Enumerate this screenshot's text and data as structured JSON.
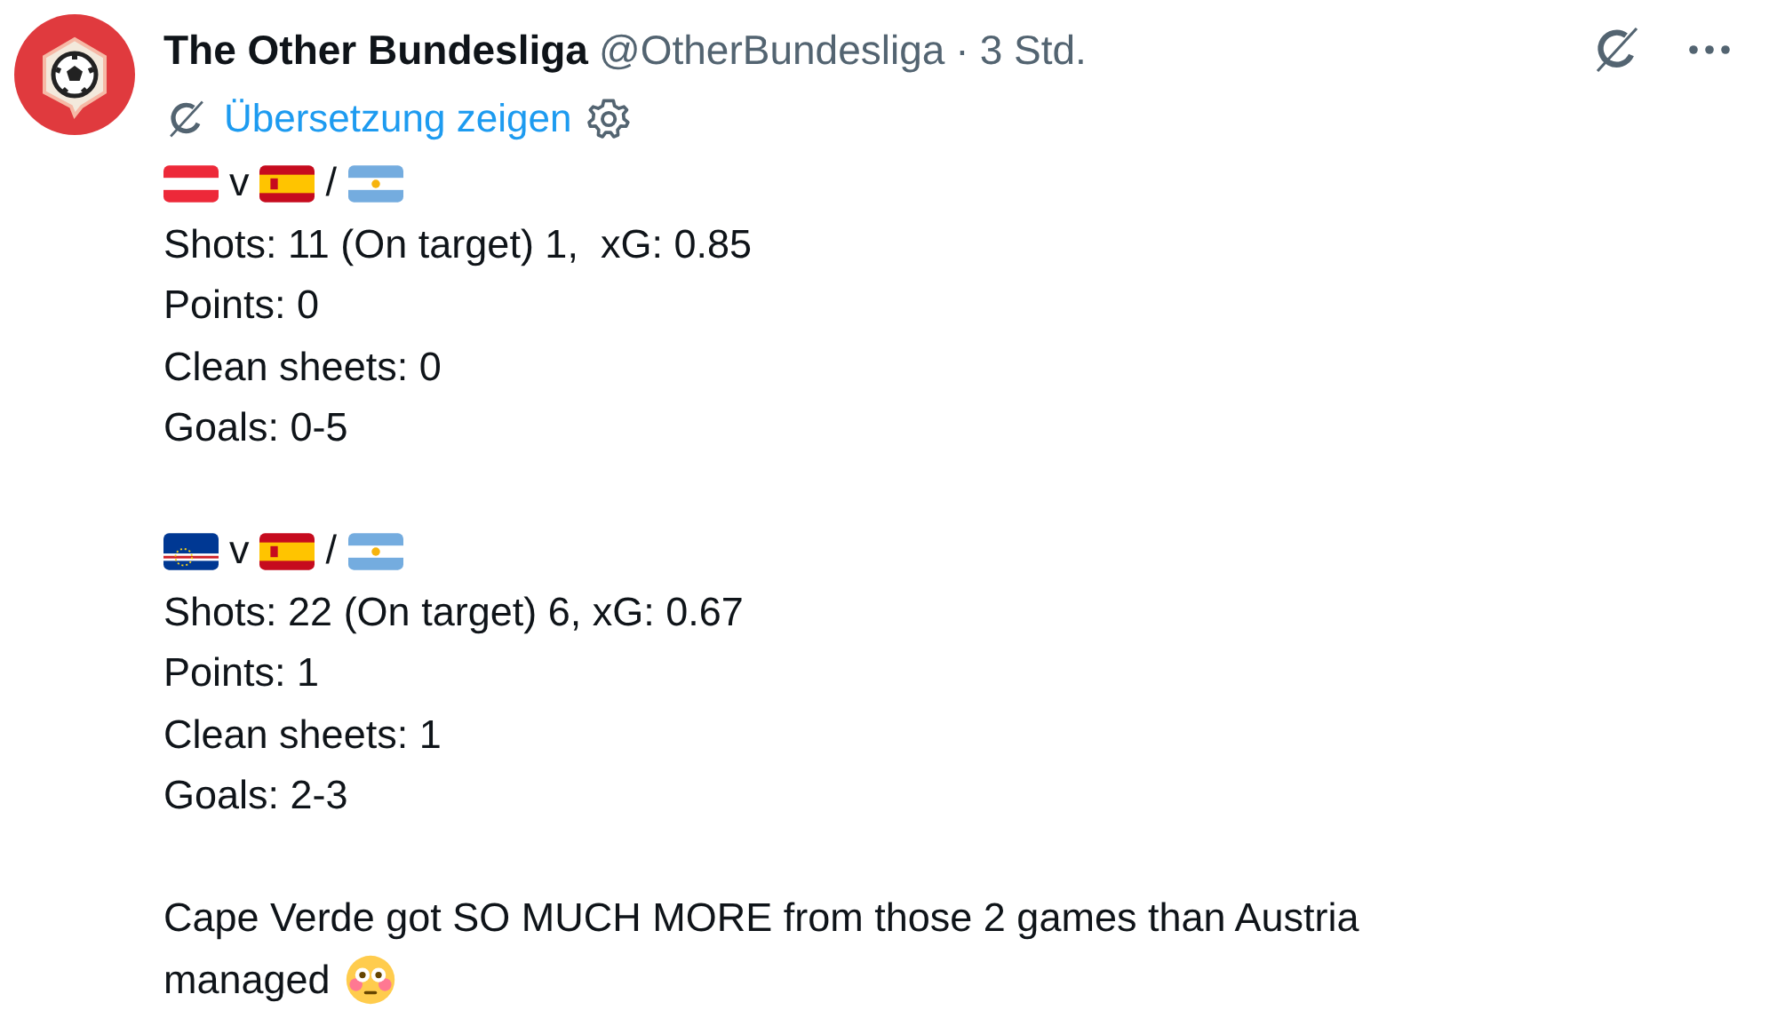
{
  "author": {
    "name": "The Other Bundesliga",
    "handle": "@OtherBundesliga",
    "separator": "·",
    "time": "3 Std."
  },
  "translate": {
    "label": "Übersetzung zeigen"
  },
  "body": [
    {
      "kind": "flags",
      "parts": [
        {
          "kind": "flag-austria"
        },
        {
          "kind": "text",
          "text": "v"
        },
        {
          "kind": "flag-spain"
        },
        {
          "kind": "text",
          "text": "/"
        },
        {
          "kind": "flag-argentina"
        }
      ]
    },
    {
      "kind": "line",
      "text": "Shots: 11 (On target) 1,  xG: 0.85"
    },
    {
      "kind": "line",
      "text": "Points: 0"
    },
    {
      "kind": "line",
      "text": "Clean sheets: 0"
    },
    {
      "kind": "line",
      "text": "Goals: 0-5"
    },
    {
      "kind": "blank"
    },
    {
      "kind": "flags",
      "parts": [
        {
          "kind": "flag-cape-verde"
        },
        {
          "kind": "text",
          "text": "v"
        },
        {
          "kind": "flag-spain"
        },
        {
          "kind": "text",
          "text": "/"
        },
        {
          "kind": "flag-argentina"
        }
      ]
    },
    {
      "kind": "line",
      "text": "Shots: 22 (On target) 6, xG: 0.67"
    },
    {
      "kind": "line",
      "text": "Points: 1"
    },
    {
      "kind": "line",
      "text": "Clean sheets: 1"
    },
    {
      "kind": "line",
      "text": "Goals: 2-3"
    },
    {
      "kind": "blank"
    },
    {
      "kind": "line",
      "text": "Cape Verde got SO MUCH MORE from those 2 games than Austria"
    },
    {
      "kind": "sentence",
      "parts": [
        {
          "kind": "text",
          "text": "managed"
        },
        {
          "kind": "emoji-flushed"
        }
      ]
    }
  ]
}
